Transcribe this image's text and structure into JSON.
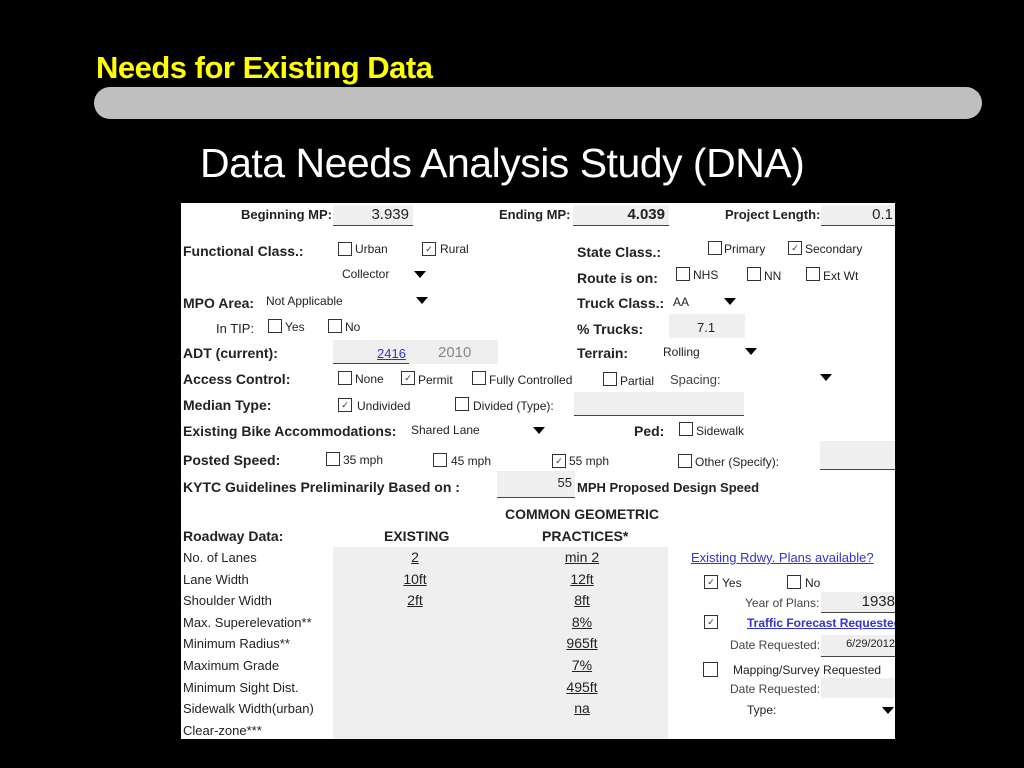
{
  "slide": {
    "title": "Needs for Existing Data",
    "subtitle": "Data Needs Analysis Study (DNA)"
  },
  "form": {
    "beginning_mp": {
      "label": "Beginning MP:",
      "value": "3.939"
    },
    "ending_mp": {
      "label": "Ending MP:",
      "value": "4.039"
    },
    "project_length": {
      "label": "Project Length:",
      "value": "0.1"
    },
    "functional_class": {
      "label": "Functional Class.:",
      "options": [
        {
          "label": "Urban",
          "checked": false
        },
        {
          "label": "Rural",
          "checked": true
        }
      ],
      "dropdown_value": "Collector"
    },
    "state_class": {
      "label": "State Class.:",
      "options": [
        {
          "label": "Primary",
          "checked": false
        },
        {
          "label": "Secondary",
          "checked": true
        }
      ]
    },
    "route_is_on": {
      "label": "Route is on:",
      "options": [
        {
          "label": "NHS",
          "checked": false
        },
        {
          "label": "NN",
          "checked": false
        },
        {
          "label": "Ext Wt",
          "checked": false
        }
      ]
    },
    "mpo_area": {
      "label": "MPO Area:",
      "value": "Not Applicable"
    },
    "truck_class": {
      "label": "Truck Class.:",
      "value": "AA"
    },
    "in_tip": {
      "label": "In TIP:",
      "options": [
        {
          "label": "Yes",
          "checked": false
        },
        {
          "label": "No",
          "checked": false
        }
      ]
    },
    "pct_trucks": {
      "label": "% Trucks:",
      "value": "7.1"
    },
    "adt": {
      "label": "ADT (current):",
      "value": "2416",
      "year": "2010"
    },
    "terrain": {
      "label": "Terrain:",
      "value": "Rolling"
    },
    "access_control": {
      "label": "Access Control:",
      "options": [
        {
          "label": "None",
          "checked": false
        },
        {
          "label": "Permit",
          "checked": true
        },
        {
          "label": "Fully Controlled",
          "checked": false
        },
        {
          "label": "Partial",
          "checked": false
        }
      ],
      "spacing_label": "Spacing:",
      "spacing_value": ""
    },
    "median_type": {
      "label": "Median Type:",
      "options": [
        {
          "label": "Undivided",
          "checked": true
        },
        {
          "label": "Divided (Type):",
          "checked": false
        }
      ],
      "divided_value": ""
    },
    "bike": {
      "label": "Existing Bike Accommodations:",
      "value": "Shared Lane"
    },
    "ped": {
      "label": "Ped:",
      "options": [
        {
          "label": "Sidewalk",
          "checked": false
        }
      ]
    },
    "posted_speed": {
      "label": "Posted Speed:",
      "options": [
        {
          "label": "35 mph",
          "checked": false
        },
        {
          "label": "45 mph",
          "checked": false
        },
        {
          "label": "55 mph",
          "checked": true
        },
        {
          "label": "Other (Specify):",
          "checked": false
        }
      ],
      "other_value": ""
    },
    "kytc": {
      "label": "KYTC Guidelines Preliminarily Based on :",
      "value": "55",
      "suffix": "MPH Proposed Design Speed"
    },
    "roadway": {
      "label": "Roadway Data:",
      "col_existing": "EXISTING",
      "col_common_1": "COMMON GEOMETRIC",
      "col_common_2": "PRACTICES*",
      "rows": [
        {
          "name": "No. of Lanes",
          "existing": "2",
          "common": "min 2"
        },
        {
          "name": "Lane Width",
          "existing": "10ft",
          "common": "12ft"
        },
        {
          "name": "Shoulder Width",
          "existing": "2ft",
          "common": "8ft"
        },
        {
          "name": "Max. Superelevation**",
          "existing": "",
          "common": "8%"
        },
        {
          "name": "Minimum Radius**",
          "existing": "",
          "common": "965ft"
        },
        {
          "name": "Maximum Grade",
          "existing": "",
          "common": "7%"
        },
        {
          "name": "Minimum Sight Dist.",
          "existing": "",
          "common": "495ft"
        },
        {
          "name": "Sidewalk Width(urban)",
          "existing": "",
          "common": "na"
        },
        {
          "name": "Clear-zone***",
          "existing": "",
          "common": ""
        }
      ]
    },
    "plans": {
      "link": "Existing Rdwy. Plans available?",
      "options": [
        {
          "label": "Yes",
          "checked": true
        },
        {
          "label": "No",
          "checked": false
        }
      ],
      "year_label": "Year of Plans:",
      "year_value": "1938",
      "traffic_link": "Traffic Forecast Requested",
      "traffic_checked": true,
      "date_label": "Date Requested:",
      "date_value": "6/29/2012",
      "mapping_label": "Mapping/Survey Requested",
      "mapping_checked": false,
      "mapping_date_label": "Date Requested:",
      "mapping_date_value": "",
      "type_label": "Type:",
      "type_value": ""
    }
  }
}
